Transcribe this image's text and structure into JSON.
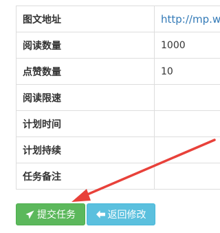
{
  "table": {
    "rows": [
      {
        "label": "图文地址",
        "value": "http://mp.w"
      },
      {
        "label": "阅读数量",
        "value": "1000"
      },
      {
        "label": "点赞数量",
        "value": "10"
      },
      {
        "label": "阅读限速",
        "value": ""
      },
      {
        "label": "计划时间",
        "value": ""
      },
      {
        "label": "计划持续",
        "value": ""
      },
      {
        "label": "任务备注",
        "value": ""
      }
    ]
  },
  "buttons": {
    "submit": {
      "label": "提交任务",
      "icon": "paper-plane-icon",
      "color": "#5cb85c"
    },
    "back": {
      "label": "返回修改",
      "icon": "arrow-left-icon",
      "color": "#5bc0de"
    }
  },
  "annotation": {
    "arrow_color": "#e8413a"
  }
}
